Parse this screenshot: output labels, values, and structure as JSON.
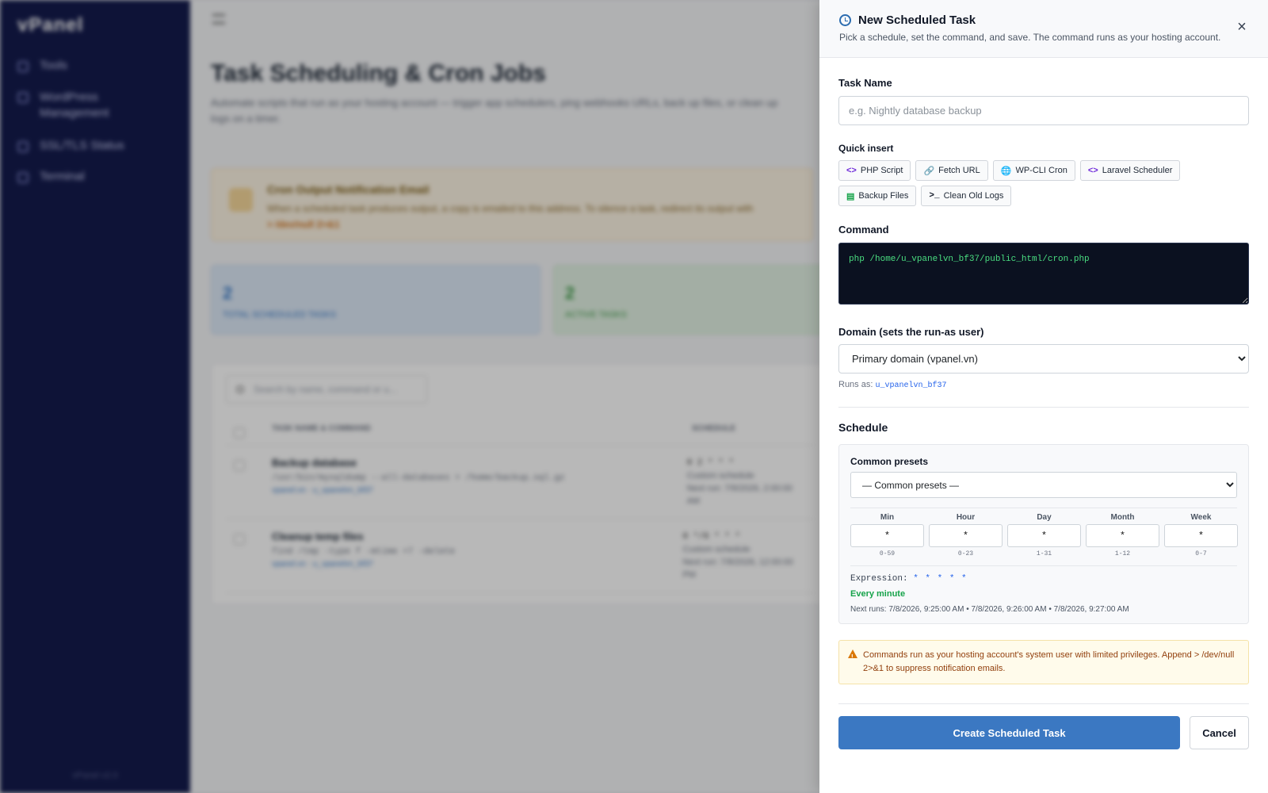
{
  "sidebar": {
    "logo": "vPanel",
    "items": [
      {
        "label": "Tools",
        "icon": "wrench-icon"
      },
      {
        "label": "WordPress Management",
        "icon": "wordpress-icon"
      },
      {
        "label": "SSL/TLS Status",
        "icon": "lock-icon"
      },
      {
        "label": "Terminal",
        "icon": "terminal-icon"
      }
    ],
    "footer": "vPanel v2.0"
  },
  "page": {
    "title": "Task Scheduling & Cron Jobs",
    "description": "Automate scripts that run as your hosting account — trigger app schedulers, ping webhooks URLs, back up files, or clean up logs on a timer.",
    "notice_title": "Cron Output Notification Email",
    "notice_desc": "When a scheduled task produces output, a copy is emailed to this address. To silence a task, redirect its output with",
    "notice_code": "> /dev/null 2>&1",
    "stats": [
      {
        "value": "2",
        "label": "TOTAL SCHEDULED TASKS"
      },
      {
        "value": "2",
        "label": "ACTIVE TASKS"
      }
    ],
    "search_placeholder": "Search by name, command or u...",
    "table_headers": [
      "TASK NAME & COMMAND",
      "SCHEDULE"
    ],
    "rows": [
      {
        "name": "Backup database",
        "command": "/usr/bin/mysqldump --all-databases > /home/backup.sql.gz",
        "meta": "vpanel.vn · u_vpanelvn_bf37",
        "schedule": "0 2 * * *",
        "sched_text": "Custom schedule",
        "next": "Next run: 7/9/2026, 2:00:00 AM"
      },
      {
        "name": "Cleanup temp files",
        "command": "find /tmp -type f -mtime +7 -delete",
        "meta": "vpanel.vn · u_vpanelvn_bf37",
        "schedule": "0 */6 * * *",
        "sched_text": "Custom schedule",
        "next": "Next run: 7/8/2026, 12:00:00 PM"
      }
    ]
  },
  "drawer": {
    "title": "New Scheduled Task",
    "subtitle": "Pick a schedule, set the command, and save. The command runs as your hosting account.",
    "task_name_label": "Task Name",
    "task_name_placeholder": "e.g. Nightly database backup",
    "quick_insert_label": "Quick insert",
    "quick_insert": [
      {
        "label": "PHP Script",
        "icon": "code-icon",
        "glyph": "<>"
      },
      {
        "label": "Fetch URL",
        "icon": "link-icon",
        "glyph": "🔗"
      },
      {
        "label": "WP-CLI Cron",
        "icon": "globe-icon",
        "glyph": "🌐"
      },
      {
        "label": "Laravel Scheduler",
        "icon": "code-icon",
        "glyph": "<>"
      },
      {
        "label": "Backup Files",
        "icon": "database-icon",
        "glyph": "▤"
      },
      {
        "label": "Clean Old Logs",
        "icon": "terminal-icon",
        "glyph": ">_"
      }
    ],
    "command_label": "Command",
    "command_value": "php /home/u_vpanelvn_bf37/public_html/cron.php",
    "domain_label": "Domain (sets the run-as user)",
    "domain_selected": "Primary domain (vpanel.vn)",
    "runs_as_label": "Runs as:",
    "runs_as_user": "u_vpanelvn_bf37",
    "schedule_label": "Schedule",
    "presets_label": "Common presets",
    "presets_selected": "— Common presets —",
    "fields": [
      {
        "label": "Min",
        "value": "*",
        "range": "0-59"
      },
      {
        "label": "Hour",
        "value": "*",
        "range": "0-23"
      },
      {
        "label": "Day",
        "value": "*",
        "range": "1-31"
      },
      {
        "label": "Month",
        "value": "*",
        "range": "1-12"
      },
      {
        "label": "Week",
        "value": "*",
        "range": "0-7"
      }
    ],
    "expression_label": "Expression:",
    "expression_value": "* * * * *",
    "human_readable": "Every minute",
    "next_runs": "Next runs: 7/8/2026, 9:25:00 AM • 7/8/2026, 9:26:00 AM • 7/8/2026, 9:27:00 AM",
    "warning": "Commands run as your hosting account's system user with limited privileges. Append > /dev/null 2>&1 to suppress notification emails.",
    "create_button": "Create Scheduled Task",
    "cancel_button": "Cancel"
  },
  "colors": {
    "sidebar_bg": "#141b4d",
    "primary": "#3b78c2",
    "command_bg": "#0b1120",
    "command_text": "#4ade80",
    "success": "#16a34a",
    "warning_bg": "#fffbeb"
  }
}
